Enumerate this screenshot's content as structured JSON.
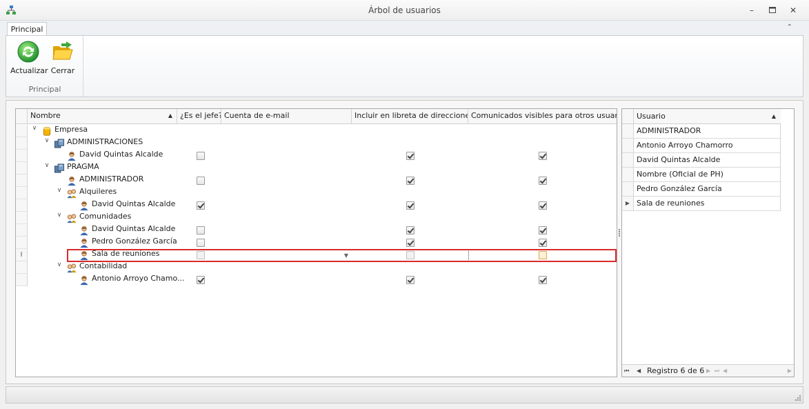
{
  "window": {
    "title": "Árbol de usuarios"
  },
  "ribbon": {
    "tab": "Principal",
    "buttons": [
      {
        "label": "Actualizar",
        "icon": "refresh-icon"
      },
      {
        "label": "Cerrar",
        "icon": "folder-close-icon"
      }
    ],
    "group_label": "Principal"
  },
  "tree_grid": {
    "columns": [
      "Nombre",
      "¿Es el jefe?",
      "Cuenta de e-mail",
      "Incluir en libreta de direcciones",
      "Comunicados visibles para otros usuarios"
    ],
    "sort_column": "Nombre",
    "rows": [
      {
        "label": "Empresa",
        "type": "company",
        "level": 0,
        "expanded": true
      },
      {
        "label": "ADMINISTRACIONES",
        "type": "server",
        "level": 1,
        "expanded": true
      },
      {
        "label": "David Quintas Alcalde",
        "type": "user",
        "level": 2,
        "jefe": false,
        "libreta": true,
        "visibles": true
      },
      {
        "label": "PRAGMA",
        "type": "server",
        "level": 1,
        "expanded": true
      },
      {
        "label": "ADMINISTRADOR",
        "type": "user",
        "level": 2,
        "jefe": false,
        "libreta": true,
        "visibles": true
      },
      {
        "label": "Alquileres",
        "type": "group",
        "level": 2,
        "expanded": true
      },
      {
        "label": "David Quintas Alcalde",
        "type": "user",
        "level": 3,
        "jefe": true,
        "libreta": true,
        "visibles": true
      },
      {
        "label": "Comunidades",
        "type": "group",
        "level": 2,
        "expanded": true
      },
      {
        "label": "David Quintas Alcalde",
        "type": "user",
        "level": 3,
        "jefe": false,
        "libreta": true,
        "visibles": true
      },
      {
        "label": "Pedro González García",
        "type": "user",
        "level": 3,
        "jefe": false,
        "libreta": true,
        "visibles": true
      },
      {
        "label": "Sala de reuniones",
        "type": "user",
        "level": 3,
        "jefe": false,
        "libreta": false,
        "visibles": false,
        "focused": true
      },
      {
        "label": "Contabilidad",
        "type": "group",
        "level": 2,
        "expanded": true
      },
      {
        "label": "Antonio Arroyo Chamo...",
        "type": "user",
        "level": 3,
        "jefe": true,
        "libreta": true,
        "visibles": true
      }
    ]
  },
  "user_grid": {
    "column": "Usuario",
    "rows": [
      "ADMINISTRADOR",
      "Antonio Arroyo Chamorro",
      "David Quintas Alcalde",
      "Nombre (Oficial de PH)",
      "Pedro González García",
      "Sala de reuniones"
    ],
    "current_index": 5,
    "navigator": "Registro 6 de 6"
  }
}
